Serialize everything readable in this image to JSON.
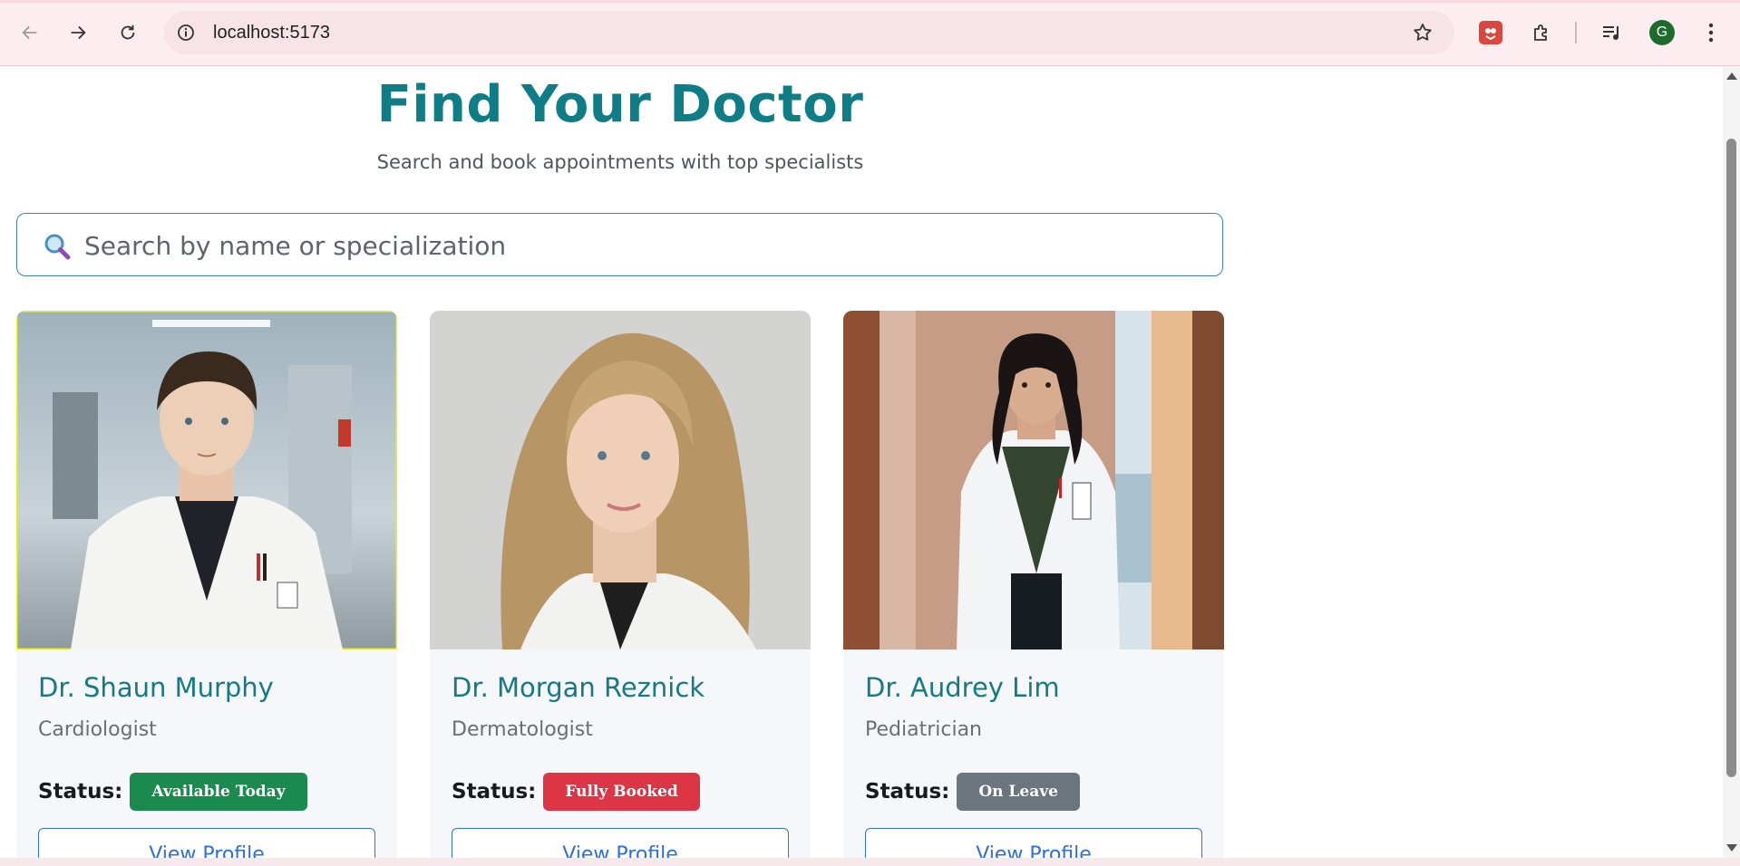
{
  "browser": {
    "url": "localhost:5173",
    "profile_initial": "G",
    "chrome_color": "#fcedf0"
  },
  "page": {
    "title": "Find Your Doctor",
    "subtitle": "Search and book appointments with top specialists",
    "search": {
      "placeholder": "Search by name or specialization",
      "value": ""
    },
    "status_label": "Status:",
    "accent_color": "#0f7d86",
    "doctors": [
      {
        "name": "Dr. Shaun Murphy",
        "specialization": "Cardiologist",
        "status": "Available Today",
        "status_color": "#1b8a4f",
        "button": "View Profile"
      },
      {
        "name": "Dr. Morgan Reznick",
        "specialization": "Dermatologist",
        "status": "Fully Booked",
        "status_color": "#dc3545",
        "button": "View Profile"
      },
      {
        "name": "Dr. Audrey Lim",
        "specialization": "Pediatrician",
        "status": "On Leave",
        "status_color": "#6c757d",
        "button": "View Profile"
      }
    ]
  }
}
